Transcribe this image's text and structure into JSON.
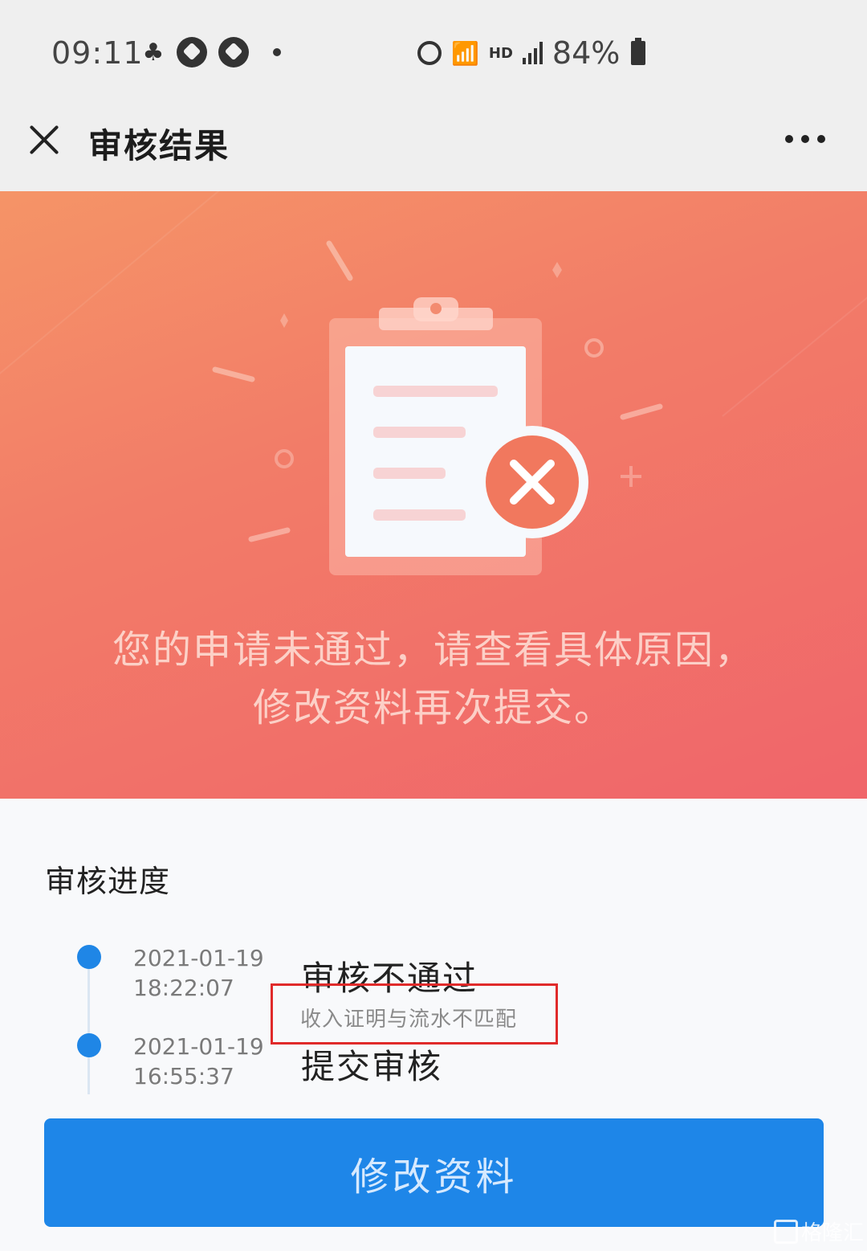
{
  "status_bar": {
    "time": "09:11",
    "battery": "84%",
    "network_label": "HD"
  },
  "nav": {
    "title": "审核结果"
  },
  "banner": {
    "message_line1": "您的申请未通过，请查看具体原因，",
    "message_line2": "修改资料再次提交。",
    "colors": {
      "start": "#f59467",
      "end": "#f0656a"
    }
  },
  "progress": {
    "title": "审核进度",
    "items": [
      {
        "date": "2021-01-19",
        "time": "18:22:07",
        "status": "审核不通过",
        "reason": "收入证明与流水不匹配"
      },
      {
        "date": "2021-01-19",
        "time": "16:55:37",
        "status": "提交审核",
        "reason": ""
      }
    ]
  },
  "actions": {
    "modify_label": "修改资料"
  },
  "watermark": {
    "text": "格隆汇"
  },
  "colors": {
    "accent": "#1e86e8",
    "highlight_border": "#e02a2a"
  }
}
